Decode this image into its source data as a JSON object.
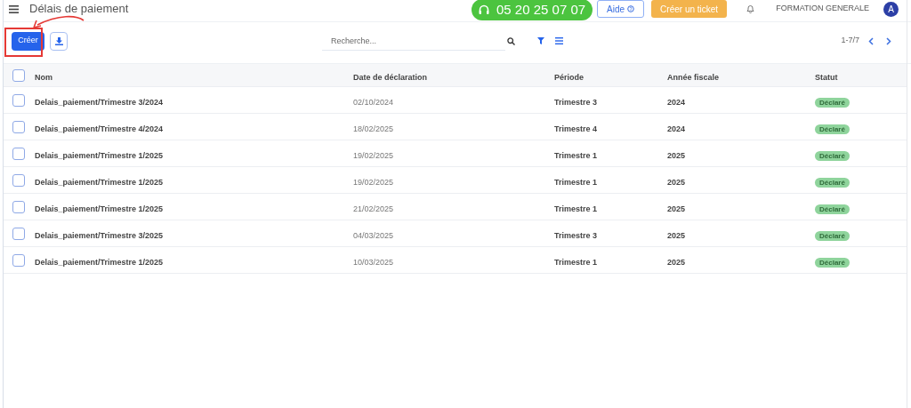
{
  "header": {
    "title": "Délais de paiement",
    "phone": "05 20 25 07 07",
    "help": "Aide",
    "ticket": "Créer un ticket",
    "company": "FORMATION GENERALE",
    "avatar": "A"
  },
  "toolbar": {
    "create": "Créer",
    "search_placeholder": "Recherche...",
    "pagination": "1-7/7"
  },
  "table": {
    "all_checked": false,
    "columns": [
      "Nom",
      "Date de déclaration",
      "Période",
      "Année fiscale",
      "Statut"
    ],
    "rows": [
      {
        "name": "Delais_paiement/Trimestre 3/2024",
        "date": "02/10/2024",
        "period": "Trimestre 3",
        "year": "2024",
        "status": "Déclaré",
        "checked": false
      },
      {
        "name": "Delais_paiement/Trimestre 4/2024",
        "date": "18/02/2025",
        "period": "Trimestre 4",
        "year": "2024",
        "status": "Déclaré",
        "checked": false
      },
      {
        "name": "Delais_paiement/Trimestre 1/2025",
        "date": "19/02/2025",
        "period": "Trimestre 1",
        "year": "2025",
        "status": "Déclaré",
        "checked": false
      },
      {
        "name": "Delais_paiement/Trimestre 1/2025",
        "date": "19/02/2025",
        "period": "Trimestre 1",
        "year": "2025",
        "status": "Déclaré",
        "checked": false
      },
      {
        "name": "Delais_paiement/Trimestre 1/2025",
        "date": "21/02/2025",
        "period": "Trimestre 1",
        "year": "2025",
        "status": "Déclaré",
        "checked": false
      },
      {
        "name": "Delais_paiement/Trimestre 3/2025",
        "date": "04/03/2025",
        "period": "Trimestre 3",
        "year": "2025",
        "status": "Déclaré",
        "checked": false
      },
      {
        "name": "Delais_paiement/Trimestre 1/2025",
        "date": "10/03/2025",
        "period": "Trimestre 1",
        "year": "2025",
        "status": "Déclaré",
        "checked": false
      }
    ]
  }
}
